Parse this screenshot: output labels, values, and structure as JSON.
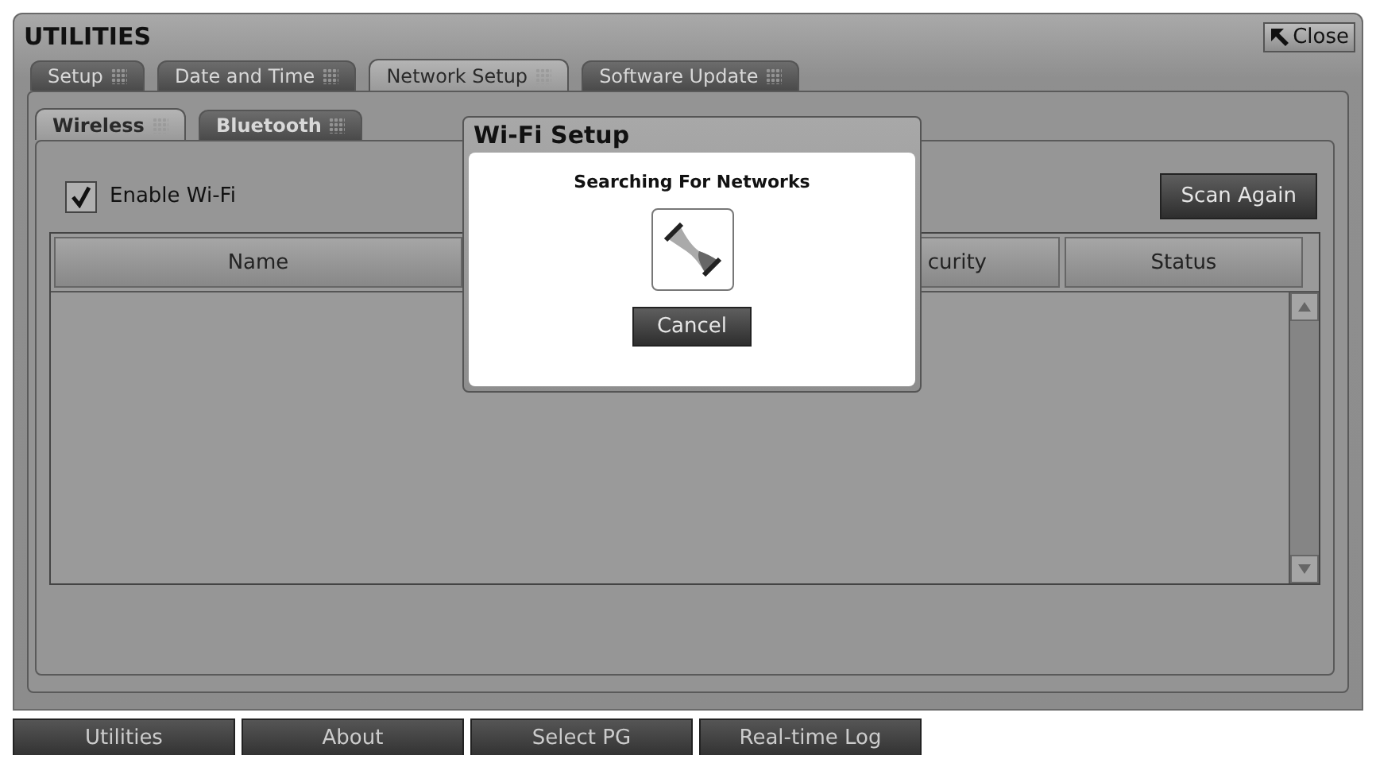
{
  "window": {
    "title": "UTILITIES",
    "close_label": "Close"
  },
  "tabs": [
    {
      "label": "Setup",
      "selected": false
    },
    {
      "label": "Date and Time",
      "selected": false
    },
    {
      "label": "Network Setup",
      "selected": true
    },
    {
      "label": "Software Update",
      "selected": false
    }
  ],
  "subtabs": [
    {
      "label": "Wireless",
      "selected": true
    },
    {
      "label": "Bluetooth",
      "selected": false
    }
  ],
  "enable_wifi": {
    "label": "Enable Wi-Fi",
    "checked": true
  },
  "scan_button": "Scan Again",
  "table": {
    "columns": [
      "Name",
      "curity",
      "Status"
    ]
  },
  "dialog": {
    "title": "Wi-Fi Setup",
    "message": "Searching For Networks",
    "cancel": "Cancel"
  },
  "nav": [
    "Utilities",
    "About",
    "Select PG",
    "Real-time Log"
  ]
}
